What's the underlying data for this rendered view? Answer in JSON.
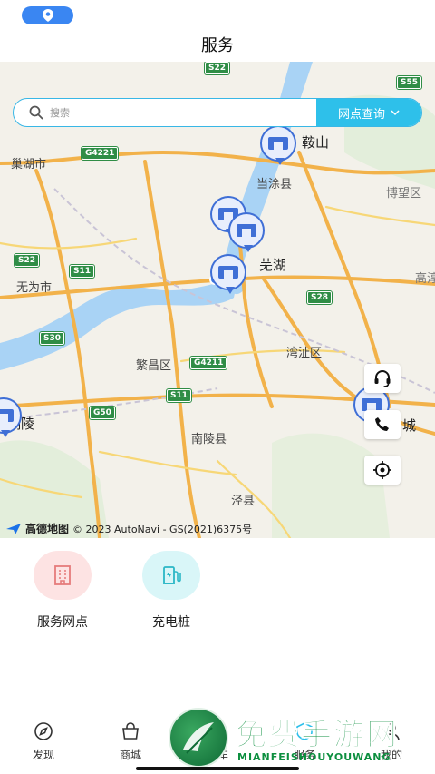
{
  "header": {
    "title": "服务"
  },
  "search": {
    "placeholder": "搜索",
    "network_query_label": "网点查询"
  },
  "map": {
    "labels": [
      "巢湖市",
      "当涂县",
      "博望区",
      "鞍山",
      "芜湖",
      "无为市",
      "高淳",
      "湾沚区",
      "繁昌区",
      "南陵县",
      "铜陵",
      "城",
      "泾县"
    ],
    "roads": [
      "S22",
      "G4221",
      "S22",
      "S11",
      "S30",
      "S28",
      "G4211",
      "S11",
      "G50",
      "S55"
    ],
    "attribution": {
      "logo_text": "高德地图",
      "copyright": "© 2023 AutoNavi - GS(2021)6375号"
    }
  },
  "services": [
    {
      "label": "服务网点",
      "icon": "building-icon",
      "bg": "#fde3e3",
      "color": "#e57b7b"
    },
    {
      "label": "充电桩",
      "icon": "charging-pile-icon",
      "bg": "#d9f6f8",
      "color": "#2bb7c6"
    }
  ],
  "tabs": [
    {
      "label": "发现",
      "icon": "discover-icon"
    },
    {
      "label": "商城",
      "icon": "shop-bag-icon"
    },
    {
      "label": "用车",
      "icon": "car-icon"
    },
    {
      "label": "服务",
      "icon": "service-icon"
    },
    {
      "label": "我的",
      "icon": "profile-icon"
    }
  ],
  "watermark": {
    "title": "免费手游网",
    "subtitle": "MIANFEISHOUYOUWANG"
  },
  "colors": {
    "accent": "#2ec0ea",
    "pin": "#3f6fd6",
    "status_pill": "#3a86f2",
    "watermark_green": "#0c8f3f"
  }
}
